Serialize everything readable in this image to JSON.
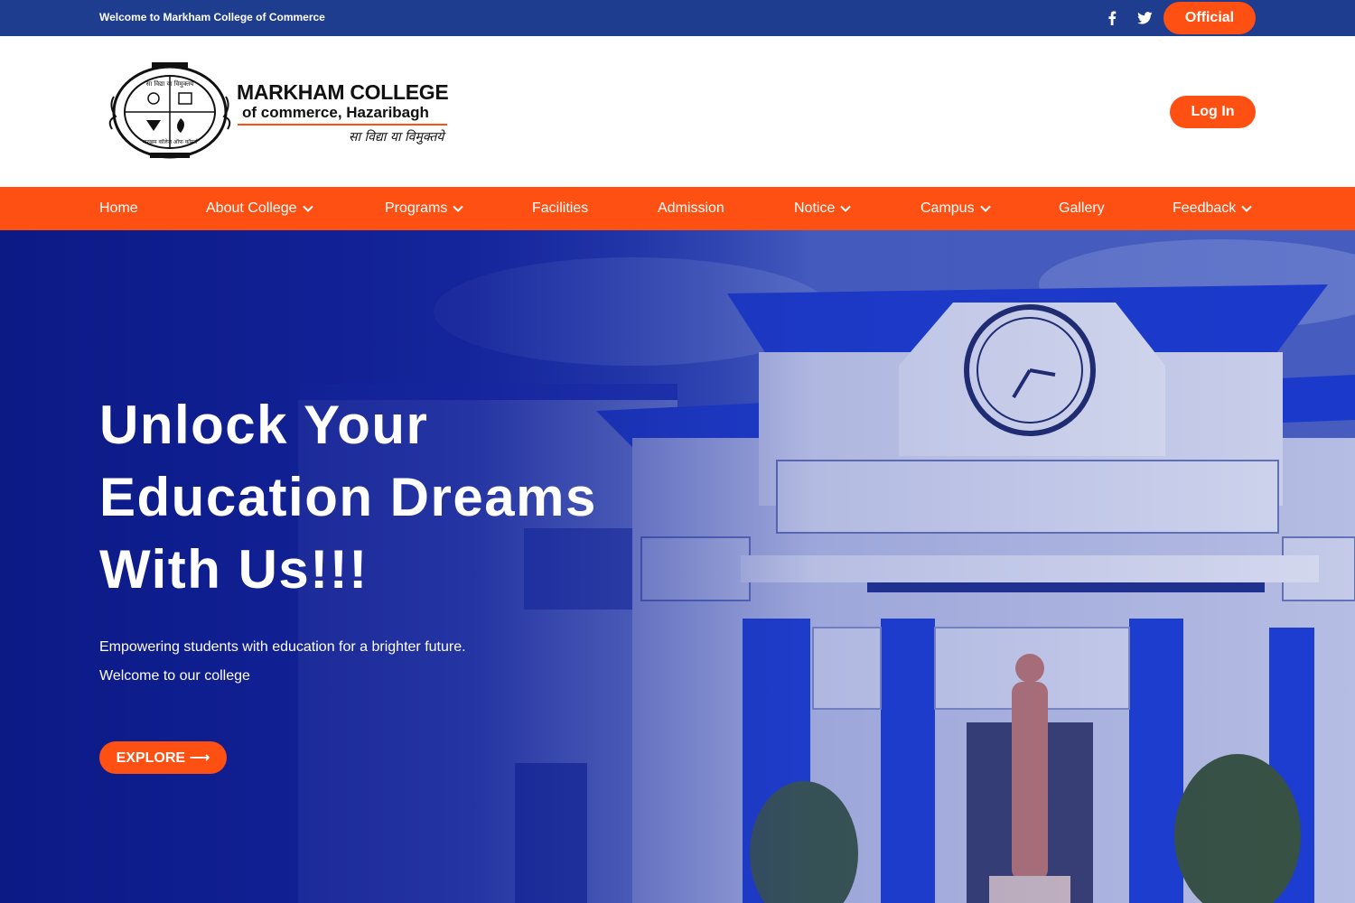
{
  "topbar": {
    "welcome": "Welcome to Markham College of Commerce",
    "social": [
      {
        "icon": "facebook-icon"
      },
      {
        "icon": "twitter-icon"
      }
    ],
    "official_label": "Official"
  },
  "header": {
    "logo": {
      "title": "MARKHAM COLLEGE",
      "subtitle": "of commerce,  Hazaribagh",
      "motto": "सा विद्या या विमुक्तये",
      "emblem_top_text": "सा विद्या या विमुक्तये",
      "emblem_bottom_text": "मारखम कॉलेज ऑफ कॉमर्स"
    },
    "login_label": "Log In"
  },
  "nav": {
    "items": [
      {
        "label": "Home",
        "dropdown": false
      },
      {
        "label": "About College",
        "dropdown": true
      },
      {
        "label": "Programs",
        "dropdown": true
      },
      {
        "label": "Facilities",
        "dropdown": false
      },
      {
        "label": "Admission",
        "dropdown": false
      },
      {
        "label": "Notice",
        "dropdown": true
      },
      {
        "label": "Campus",
        "dropdown": true
      },
      {
        "label": "Gallery",
        "dropdown": false
      },
      {
        "label": "Feedback",
        "dropdown": true
      }
    ]
  },
  "hero": {
    "title_lines": [
      "Unlock Your",
      "Education Dreams",
      "With Us!!!"
    ],
    "subtitle": "Empowering students with education for a brighter future. Welcome to our college",
    "cta_label": "EXPLORE ⟶"
  },
  "colors": {
    "topbar": "#1f3d8f",
    "accent": "#ff5014",
    "hero_overlay": "#14249a",
    "text_on_dark": "#ffffff"
  }
}
